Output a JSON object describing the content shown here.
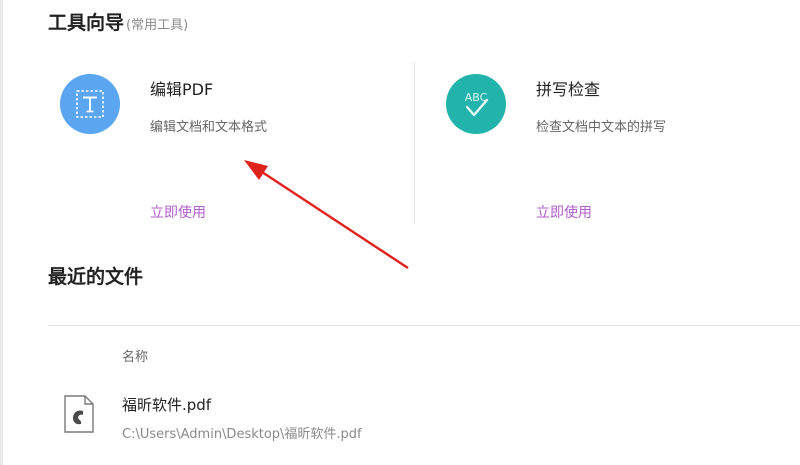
{
  "tool_guide": {
    "title": "工具向导",
    "subtitle": "(常用工具)",
    "tools": [
      {
        "name": "编辑PDF",
        "description": "编辑文档和文本格式",
        "action": "立即使用",
        "icon": "edit-text-icon",
        "color": "#5aa6f0"
      },
      {
        "name": "拼写检查",
        "description": "检查文档中文本的拼写",
        "action": "立即使用",
        "icon": "spell-check-icon",
        "color": "#22b3ad",
        "icon_text": "ABC"
      }
    ]
  },
  "recent_files": {
    "title": "最近的文件",
    "column_header": "名称",
    "files": [
      {
        "name": "福昕软件.pdf",
        "path": "C:\\Users\\Admin\\Desktop\\福昕软件.pdf",
        "icon": "pdf-file-icon"
      }
    ]
  },
  "annotation": {
    "arrow_color": "#e0221c"
  }
}
